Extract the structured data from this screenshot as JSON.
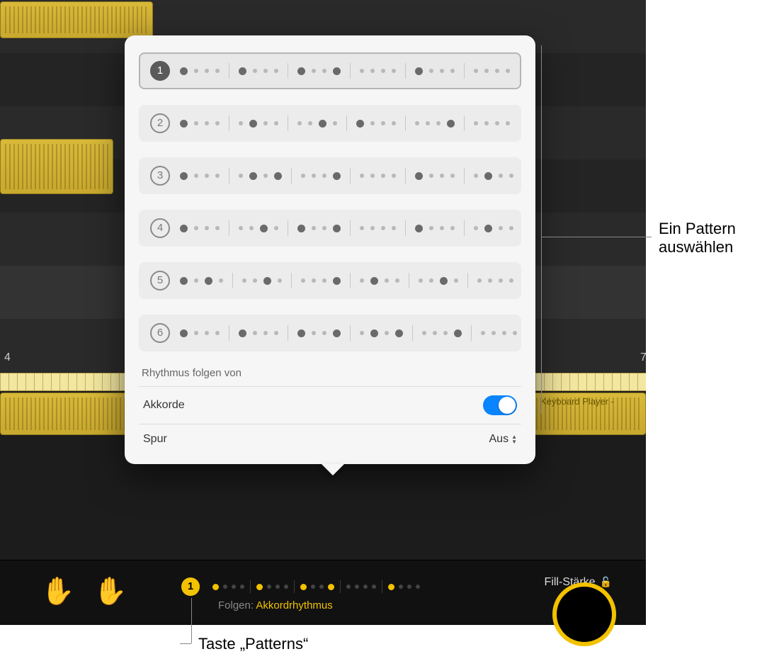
{
  "timeline": {
    "bar_label_left": "4",
    "bar_label_right": "7",
    "region_label": "Keyboard Player -"
  },
  "popover": {
    "patterns": [
      {
        "num": "1",
        "selected": true,
        "beats": [
          [
            2,
            0,
            0,
            0
          ],
          [
            2,
            0,
            0,
            0
          ],
          [
            2,
            0,
            0,
            2
          ],
          [
            0,
            0,
            0,
            0
          ],
          [
            2,
            0,
            0,
            0
          ],
          [
            0,
            0,
            0,
            0
          ]
        ]
      },
      {
        "num": "2",
        "selected": false,
        "beats": [
          [
            2,
            0,
            0,
            0
          ],
          [
            0,
            2,
            0,
            0
          ],
          [
            0,
            0,
            2,
            0
          ],
          [
            2,
            0,
            0,
            0
          ],
          [
            0,
            0,
            0,
            2
          ],
          [
            0,
            0,
            0,
            0
          ]
        ]
      },
      {
        "num": "3",
        "selected": false,
        "beats": [
          [
            2,
            0,
            0,
            0
          ],
          [
            0,
            2,
            0,
            2
          ],
          [
            0,
            0,
            0,
            2
          ],
          [
            0,
            0,
            0,
            0
          ],
          [
            2,
            0,
            0,
            0
          ],
          [
            0,
            2,
            0,
            0
          ]
        ]
      },
      {
        "num": "4",
        "selected": false,
        "beats": [
          [
            2,
            0,
            0,
            0
          ],
          [
            0,
            0,
            2,
            0
          ],
          [
            2,
            0,
            0,
            2
          ],
          [
            0,
            0,
            0,
            0
          ],
          [
            2,
            0,
            0,
            0
          ],
          [
            0,
            2,
            0,
            0
          ]
        ]
      },
      {
        "num": "5",
        "selected": false,
        "beats": [
          [
            2,
            0,
            2,
            0
          ],
          [
            0,
            0,
            2,
            0
          ],
          [
            0,
            0,
            0,
            2
          ],
          [
            0,
            2,
            0,
            0
          ],
          [
            0,
            0,
            2,
            0
          ],
          [
            0,
            0,
            0,
            0
          ]
        ]
      },
      {
        "num": "6",
        "selected": false,
        "beats": [
          [
            2,
            0,
            0,
            0
          ],
          [
            2,
            0,
            0,
            0
          ],
          [
            2,
            0,
            0,
            2
          ],
          [
            0,
            2,
            0,
            2
          ],
          [
            0,
            0,
            0,
            2
          ],
          [
            0,
            0,
            0,
            0
          ]
        ]
      }
    ],
    "section_label": "Rhythmus folgen von",
    "settings": {
      "akkorde_label": "Akkorde",
      "akkorde_on": true,
      "spur_label": "Spur",
      "spur_value": "Aus"
    }
  },
  "bottom": {
    "pattern_number": "1",
    "follow_label": "Folgen: ",
    "follow_value": "Akkordrhythmus",
    "fill_label": "Fill-Stärke"
  },
  "callouts": {
    "select_pattern_l1": "Ein Pattern",
    "select_pattern_l2": "auswählen",
    "patterns_button": "Taste „Patterns“"
  }
}
